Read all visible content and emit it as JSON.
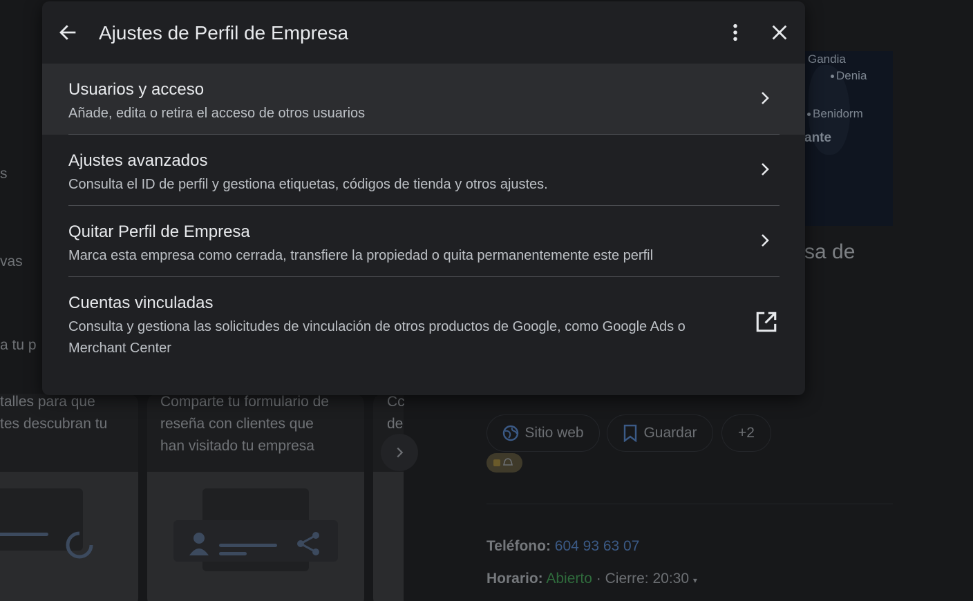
{
  "dialog": {
    "title": "Ajustes de Perfil de Empresa",
    "back_icon": "arrow-back-icon",
    "more_icon": "more-vert-icon",
    "close_icon": "close-icon",
    "items": [
      {
        "title": "Usuarios y acceso",
        "description": "Añade, edita o retira el acceso de otros usuarios",
        "icon": "chevron-right-icon"
      },
      {
        "title": "Ajustes avanzados",
        "description": "Consulta el ID de perfil y gestiona etiquetas, códigos de tienda y otros ajustes.",
        "icon": "chevron-right-icon"
      },
      {
        "title": "Quitar Perfil de Empresa",
        "description": "Marca esta empresa como cerrada, transfiere la propiedad o quita permanentemente este perfil",
        "icon": "chevron-right-icon"
      },
      {
        "title": "Cuentas vinculadas",
        "description": "Consulta y gestiona las solicitudes de vinculación de otros productos de Google, como Google Ads o Merchant Center",
        "icon": "open-in-new-icon"
      }
    ]
  },
  "background": {
    "left_fragments": [
      "s",
      "vas",
      "a tu p"
    ],
    "card1_text": [
      "talles para que",
      "tes descubran tu"
    ],
    "card2_text": [
      "Comparte tu formulario de",
      "reseña con clientes que",
      "han visitado tu empresa"
    ],
    "card3_text": [
      "Cc",
      "de"
    ],
    "map_labels": [
      "Gandia",
      "Denia",
      "Benidorm",
      "ante"
    ],
    "business_name_fragment": "sa de",
    "actions": {
      "website": "Sitio web",
      "save": "Guardar",
      "more": "+2"
    },
    "phone_label": "Teléfono:",
    "phone_value": "604 93 63 07",
    "hours_label": "Horario:",
    "hours_status": "Abierto",
    "hours_separator": "·",
    "hours_close": "Cierre: 20:30"
  },
  "colors": {
    "dialog_bg": "#1f2023",
    "active_item_bg": "#2c2d30",
    "text_primary": "#e8eaed",
    "text_secondary": "#bdc1c6"
  }
}
